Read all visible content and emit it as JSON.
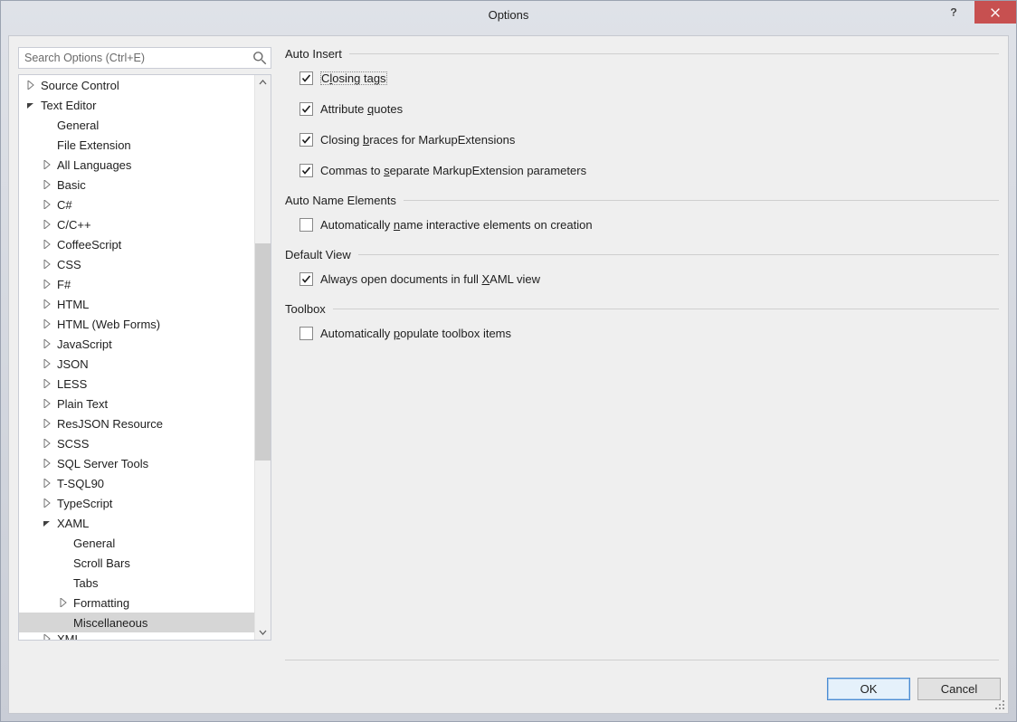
{
  "window": {
    "title": "Options"
  },
  "search": {
    "placeholder": "Search Options (Ctrl+E)"
  },
  "tree": [
    {
      "label": "Source Control",
      "exp": "collapsed",
      "depth": 0
    },
    {
      "label": "Text Editor",
      "exp": "expanded",
      "depth": 0
    },
    {
      "label": "General",
      "exp": "leaf",
      "depth": 1
    },
    {
      "label": "File Extension",
      "exp": "leaf",
      "depth": 1
    },
    {
      "label": "All Languages",
      "exp": "collapsed",
      "depth": 1
    },
    {
      "label": "Basic",
      "exp": "collapsed",
      "depth": 1
    },
    {
      "label": "C#",
      "exp": "collapsed",
      "depth": 1
    },
    {
      "label": "C/C++",
      "exp": "collapsed",
      "depth": 1
    },
    {
      "label": "CoffeeScript",
      "exp": "collapsed",
      "depth": 1
    },
    {
      "label": "CSS",
      "exp": "collapsed",
      "depth": 1
    },
    {
      "label": "F#",
      "exp": "collapsed",
      "depth": 1
    },
    {
      "label": "HTML",
      "exp": "collapsed",
      "depth": 1
    },
    {
      "label": "HTML (Web Forms)",
      "exp": "collapsed",
      "depth": 1
    },
    {
      "label": "JavaScript",
      "exp": "collapsed",
      "depth": 1
    },
    {
      "label": "JSON",
      "exp": "collapsed",
      "depth": 1
    },
    {
      "label": "LESS",
      "exp": "collapsed",
      "depth": 1
    },
    {
      "label": "Plain Text",
      "exp": "collapsed",
      "depth": 1
    },
    {
      "label": "ResJSON Resource",
      "exp": "collapsed",
      "depth": 1
    },
    {
      "label": "SCSS",
      "exp": "collapsed",
      "depth": 1
    },
    {
      "label": "SQL Server Tools",
      "exp": "collapsed",
      "depth": 1
    },
    {
      "label": "T-SQL90",
      "exp": "collapsed",
      "depth": 1
    },
    {
      "label": "TypeScript",
      "exp": "collapsed",
      "depth": 1
    },
    {
      "label": "XAML",
      "exp": "expanded",
      "depth": 1
    },
    {
      "label": "General",
      "exp": "leaf",
      "depth": 2
    },
    {
      "label": "Scroll Bars",
      "exp": "leaf",
      "depth": 2
    },
    {
      "label": "Tabs",
      "exp": "leaf",
      "depth": 2
    },
    {
      "label": "Formatting",
      "exp": "collapsed",
      "depth": 2
    },
    {
      "label": "Miscellaneous",
      "exp": "leaf",
      "depth": 2,
      "selected": true
    },
    {
      "label": "XML",
      "exp": "collapsed",
      "depth": 1,
      "cut": true
    }
  ],
  "groups": {
    "autoinsert": {
      "title": "Auto Insert",
      "opts": [
        {
          "html": "C<span class='mnemonic'>l</span>osing tags",
          "checked": true,
          "focused": true,
          "name": "closing-tags"
        },
        {
          "html": "Attribute <span class='mnemonic'>q</span>uotes",
          "checked": true,
          "name": "attribute-quotes"
        },
        {
          "html": "Closing <span class='mnemonic'>b</span>races for MarkupExtensions",
          "checked": true,
          "name": "closing-braces"
        },
        {
          "html": "Commas to <span class='mnemonic'>s</span>eparate MarkupExtension parameters",
          "checked": true,
          "name": "commas-separate"
        }
      ]
    },
    "autoname": {
      "title": "Auto Name Elements",
      "opts": [
        {
          "html": "Automatically <span class='mnemonic'>n</span>ame interactive elements on creation",
          "checked": false,
          "name": "auto-name"
        }
      ]
    },
    "defaultview": {
      "title": "Default View",
      "opts": [
        {
          "html": "Always open documents in full <span class='mnemonic'>X</span>AML view",
          "checked": true,
          "name": "full-xaml-view"
        }
      ]
    },
    "toolbox": {
      "title": "Toolbox",
      "opts": [
        {
          "html": "Automatically <span class='mnemonic'>p</span>opulate toolbox items",
          "checked": false,
          "name": "populate-toolbox"
        }
      ]
    }
  },
  "buttons": {
    "ok": "OK",
    "cancel": "Cancel"
  }
}
